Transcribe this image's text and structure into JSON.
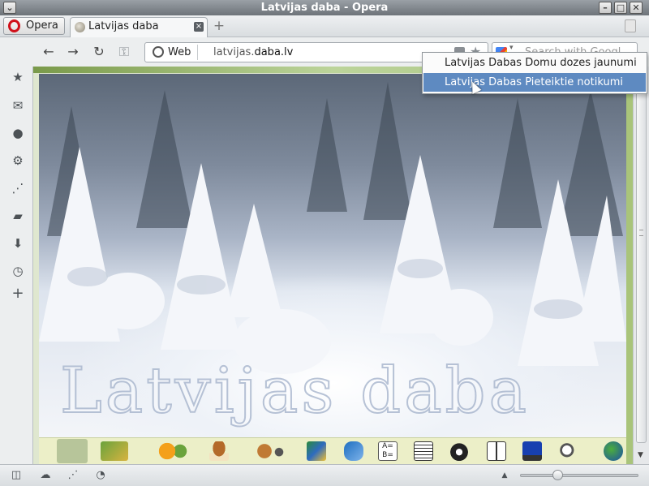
{
  "window": {
    "title": "Latvijas daba - Opera",
    "buttons": {
      "menu": "⌄",
      "minimize": "–",
      "maximize": "□",
      "close": "✕"
    }
  },
  "menu_button": {
    "label": "Opera",
    "icon": "opera-logo-icon"
  },
  "tabs": [
    {
      "label": "Latvijas daba",
      "active": true,
      "icon": "site-favicon"
    }
  ],
  "toolbar": {
    "back_icon": "arrow-left-icon",
    "forward_icon": "arrow-right-icon",
    "reload_icon": "reload-icon",
    "key_icon": "key-icon",
    "address": {
      "badge": "Web",
      "url_prefix": "latvijas.",
      "url_domain": "daba.lv"
    },
    "search": {
      "placeholder": "Search with Googl",
      "engine_icon": "google-icon"
    }
  },
  "feed_dropdown": {
    "items": [
      {
        "label": "Latvijas Dabas Domu dozes jaunumi",
        "highlighted": false
      },
      {
        "label": "Latvijas Dabas Pieteiktie notikumi",
        "highlighted": true
      }
    ]
  },
  "side_panel": {
    "icons": [
      "bookmarks-star-icon",
      "mail-icon",
      "contacts-icon",
      "widgets-gear-icon",
      "unite-network-icon",
      "notes-icon",
      "downloads-icon",
      "history-clock-icon",
      "add-panel-plus-icon"
    ]
  },
  "page": {
    "hero_title": "Latvijas daba",
    "icon_strip": [
      "home-icon",
      "mushroom-forest-icon",
      "flowers-icon",
      "mushroom-icon",
      "animals-icon",
      "map-icon",
      "fish-icon",
      "alphabet-icon",
      "table-icon",
      "camera-icon",
      "book-icon",
      "computer-icon",
      "search-doc-icon",
      "globe-icon"
    ]
  },
  "status_bar": {
    "icons": [
      "panel-toggle-icon",
      "turbo-cloud-icon",
      "unite-icon",
      "speed-dial-icon"
    ],
    "zoom": {
      "percent": 100,
      "fraction": 0.3
    }
  },
  "colors": {
    "accent_highlight": "#5e8ac1",
    "page_green": "#a9c47a",
    "icon_strip_bg": "#ecefc8"
  }
}
